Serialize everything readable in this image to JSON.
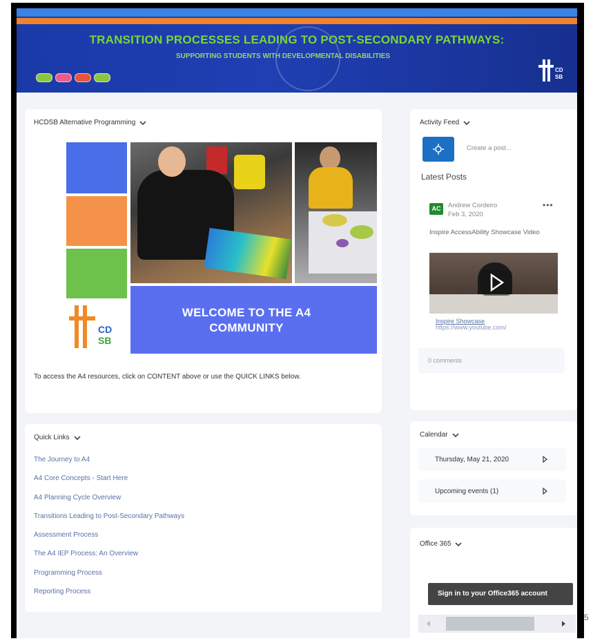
{
  "banner": {
    "title": "TRANSITION PROCESSES LEADING TO POST-SECONDARY PATHWAYS:",
    "subtitle": "SUPPORTING STUDENTS WITH DEVELOPMENTAL DISABILITIES",
    "dot_colors": [
      "#8cc63f",
      "#e85d8a",
      "#e8553d",
      "#8cc63f"
    ],
    "logo_text": "CD SB"
  },
  "main_widget": {
    "title": "HCDSB Alternative Programming",
    "graphic_logo": {
      "letters_top": "CD",
      "letters_bottom": "SB"
    },
    "welcome_line1": "WELCOME TO THE A4",
    "welcome_line2": "COMMUNITY",
    "access_text": "To access the A4 resources, click on CONTENT above or use the QUICK LINKS below."
  },
  "quick_links": {
    "title": "Quick Links",
    "items": [
      "The Journey to A4",
      "A4 Core Concepts - Start Here",
      "A4 Planning Cycle Overview",
      "Transitions Leading to Post-Secondary Pathways",
      "Assessment Process",
      "The A4 IEP Process:  An Overview",
      "Programming Process",
      "Reporting Process"
    ]
  },
  "activity_feed": {
    "title": "Activity Feed",
    "create_placeholder": "Create a post...",
    "latest_heading": "Latest Posts",
    "post": {
      "avatar_initials": "AC",
      "author": "Andrew Cordeiro",
      "date": "Feb 3, 2020",
      "title": "Inspire AccessAbility Showcase Video",
      "link_title": "Inspire Showcase",
      "link_url": "https://www.youtube.com/",
      "comments": "0 comments"
    }
  },
  "calendar": {
    "title": "Calendar",
    "date_label": "Thursday, May 21, 2020",
    "upcoming_label": "Upcoming events (1)"
  },
  "office365": {
    "title": "Office 365",
    "signin_label": "Sign in to your Office365 account"
  },
  "colors": {
    "accent_blue": "#1c6fc4",
    "banner_orange": "#f0832b",
    "welcome_blue": "#5a6ff0",
    "block_blue": "#4a6ee8",
    "block_orange": "#f5924a",
    "block_green": "#6cc24a",
    "logo_orange": "#f08a24",
    "link_color": "#5a70a6"
  },
  "edge_text": "5"
}
